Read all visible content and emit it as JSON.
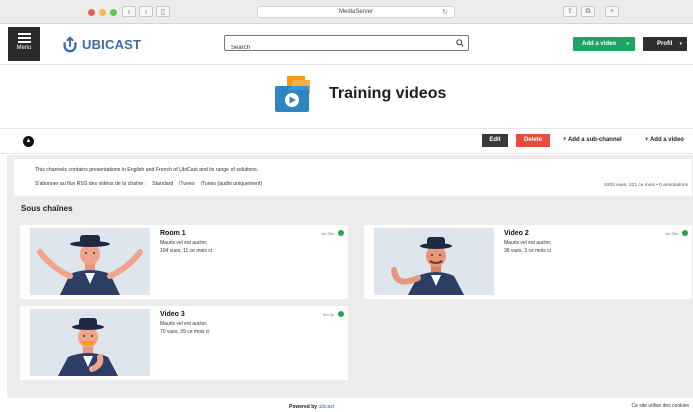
{
  "browser": {
    "url": "MediaServer",
    "controls": {
      "back": "‹",
      "forward": "›",
      "sidebar": "▯",
      "reload": "↻",
      "share": "⇧",
      "tabs": "⧉",
      "new_tab": "+"
    }
  },
  "header": {
    "menu_label": "Menu",
    "logo_text": "UBICAST",
    "search_placeholder": "Search",
    "add_video_label": "Add a video",
    "profil_label": "Profil",
    "caret": "▾",
    "colors": {
      "brand": "#3d6da6",
      "add_video": "#1ba464",
      "dark": "#2b2b2b"
    }
  },
  "channel": {
    "title": "Training videos",
    "toolbar": {
      "collapse_icon": "▲",
      "edit": "Edit",
      "delete": "Delete",
      "add_subchannel": "+ Add a sub-channel",
      "add_video": "+ Add a video"
    },
    "description": "This channels contains presentations in English and French of UbiCast and its range of solutions.",
    "rss": {
      "label": "S'abonner au flux RSS des vidéos de la chaîne :",
      "standard": "Standard",
      "itunes": "iTunes",
      "itunes_audio": "iTunes (audio uniquement)"
    },
    "stats": "9203 vues, 221 ce mois • 0 annotations"
  },
  "section": {
    "title": "Sous chaînes"
  },
  "cards": [
    {
      "title": "Room 1",
      "subtitle": "Mauris vel est auctor,",
      "views": "104 vues, 11 ce mois ci",
      "duration": "1m 30s"
    },
    {
      "title": "Video 2",
      "subtitle": "Mauris vel est auctor,",
      "views": "36 vues, 3 ce mois ci",
      "duration": "1m 30s"
    },
    {
      "title": "Video 3",
      "subtitle": "Mauris vel est auctor,",
      "views": "70 vues, 39 ce mois ci",
      "duration": "5m 3s"
    }
  ],
  "footer": {
    "powered_by": "Powered by",
    "powered_brand": "ubicast",
    "cookies": "Ce site utilise des cookies"
  }
}
